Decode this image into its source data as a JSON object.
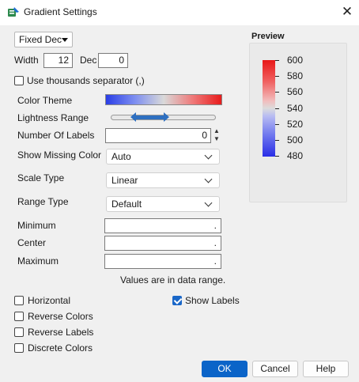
{
  "window": {
    "title": "Gradient Settings",
    "close_glyph": "✕"
  },
  "format": {
    "selected": "Fixed Dec",
    "width_label": "Width",
    "width_value": "12",
    "dec_label": "Dec",
    "dec_value": "0"
  },
  "thousands": {
    "label": "Use thousands separator (,)",
    "checked": false
  },
  "color_theme": {
    "label": "Color Theme"
  },
  "lightness": {
    "label": "Lightness Range"
  },
  "num_labels": {
    "label": "Number Of Labels",
    "value": "0"
  },
  "missing_color": {
    "label": "Show Missing Color",
    "value": "Auto"
  },
  "scale_type": {
    "label": "Scale Type",
    "value": "Linear"
  },
  "range_type": {
    "label": "Range Type",
    "value": "Default"
  },
  "minimum": {
    "label": "Minimum",
    "value": "."
  },
  "center": {
    "label": "Center",
    "value": "."
  },
  "maximum": {
    "label": "Maximum",
    "value": "."
  },
  "range_note": "Values are in data range.",
  "options": {
    "horizontal": {
      "label": "Horizontal",
      "checked": false
    },
    "reverse_colors": {
      "label": "Reverse Colors",
      "checked": false
    },
    "reverse_labels": {
      "label": "Reverse Labels",
      "checked": false
    },
    "discrete_colors": {
      "label": "Discrete Colors",
      "checked": false
    },
    "show_labels": {
      "label": "Show Labels",
      "checked": true
    }
  },
  "preview": {
    "title": "Preview",
    "labels": [
      "600",
      "580",
      "560",
      "540",
      "520",
      "500",
      "480"
    ],
    "max_color": "#e81818",
    "mid_color": "#dcdcdc",
    "min_color": "#2a2ee6"
  },
  "buttons": {
    "ok": "OK",
    "cancel": "Cancel",
    "help": "Help"
  },
  "colors": {
    "accent": "#0b64c8"
  },
  "icons": {
    "app": "gradient-settings-icon",
    "close": "close-icon"
  }
}
